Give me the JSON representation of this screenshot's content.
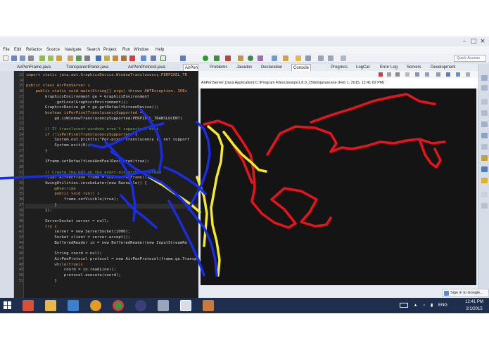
{
  "menu": [
    "File",
    "Edit",
    "Refactor",
    "Source",
    "Navigate",
    "Search",
    "Project",
    "Run",
    "Window",
    "Help"
  ],
  "quick_access_label": "Quick Access",
  "editor_tabs": [
    "AirPenFrame.java",
    "TransparentPanel.java",
    "AirPenProtocol.java",
    "AirPen"
  ],
  "console_tabs": [
    "Problems",
    "Javadoc",
    "Declaration",
    "Console",
    "Progress",
    "LogCat",
    "Error Log",
    "Servers",
    "Development"
  ],
  "console_header": "AirPenServer [Java Application] C:\\Program Files\\Java\\jre1.8.0_25\\bin\\javaw.exe (Feb 1, 2015, 12:41:02 PM)",
  "sign_in_label": "Sign in to Google...",
  "taskbar": {
    "language": "ENG",
    "time": "12:41 PM",
    "date": "2/1/2015"
  },
  "code_lines": [
    {
      "n": "13",
      "t": "import static java.awt.GraphicsDevice.WindowTranslucency.PERPIXEL_TR"
    },
    {
      "n": "14",
      "t": ""
    },
    {
      "n": "15",
      "t": "public class AirPenServer {"
    },
    {
      "n": "16",
      "t": "    public static void main(String[] args) throws AWTException, IOEx"
    },
    {
      "n": "17",
      "t": "        GraphicsEnvironment ge = GraphicsEnvironment"
    },
    {
      "n": "18",
      "t": "            .getLocalGraphicsEnvironment();"
    },
    {
      "n": "19",
      "t": "        GraphicsDevice gd = ge.getDefaultScreenDevice();"
    },
    {
      "n": "20",
      "t": "        boolean isPerPixelTranslucencySupported ="
    },
    {
      "n": "21",
      "t": "            gd.isWindowTranslucencySupported(PERPIXEL_TRANSLUCENT)"
    },
    {
      "n": "22",
      "t": ""
    },
    {
      "n": "23",
      "t": "        // If translucent windows aren't supported, exit."
    },
    {
      "n": "24",
      "t": "        if (!isPerPixelTranslucencySupported) {"
    },
    {
      "n": "25",
      "t": "            System.out.println(\"Per-pixel translucency is not support"
    },
    {
      "n": "26",
      "t": "            System.exit(0);"
    },
    {
      "n": "27",
      "t": "        }"
    },
    {
      "n": "28",
      "t": ""
    },
    {
      "n": "29",
      "t": "        JFrame.setDefaultLookAndFeelDecorated(true);"
    },
    {
      "n": "30",
      "t": ""
    },
    {
      "n": "31",
      "t": "        // Create the GUI on the event-dispatching thread"
    },
    {
      "n": "32",
      "t": "        final AirPenFrame frame = new AirPenFrame();"
    },
    {
      "n": "33",
      "t": "        SwingUtilities.invokeLater(new Runnable() {"
    },
    {
      "n": "34",
      "t": "            @Override"
    },
    {
      "n": "35",
      "t": "            public void run() {"
    },
    {
      "n": "36",
      "t": "                frame.setVisible(true);"
    },
    {
      "n": "37",
      "t": "            }"
    },
    {
      "n": "38",
      "t": "        });"
    },
    {
      "n": "39",
      "t": ""
    },
    {
      "n": "40",
      "t": "        ServerSocket server = null;"
    },
    {
      "n": "41",
      "t": "        try {"
    },
    {
      "n": "42",
      "t": "            server = new ServerSocket(1000);"
    },
    {
      "n": "43",
      "t": "            Socket client = server.accept();"
    },
    {
      "n": "44",
      "t": "            BufferedReader in = new BufferedReader(new InputStreamRe"
    },
    {
      "n": "45",
      "t": ""
    },
    {
      "n": "46",
      "t": "            String coord = null;"
    },
    {
      "n": "47",
      "t": "            AirPenProtocol protocol = new AirPenProtocol(frame.ge.TransparentPanel());"
    },
    {
      "n": "48",
      "t": "            while(true){"
    },
    {
      "n": "49",
      "t": "                coord = in.readLine();"
    },
    {
      "n": "50",
      "t": "                protocol.execute(coord);"
    },
    {
      "n": "51",
      "t": "            }"
    }
  ],
  "colors": {
    "stroke_red": "#e8141b",
    "stroke_yellow": "#f2ea2a",
    "stroke_blue": "#1a2de0",
    "editor_bg": "#1e1e1e",
    "console_bg": "#141414",
    "taskbar_bg": "#1d2f4d"
  },
  "icons": [
    "save-icon",
    "run-icon",
    "debug-icon",
    "search-icon",
    "terminate-icon",
    "chrome-icon",
    "eclipse-icon",
    "file-explorer-icon"
  ]
}
